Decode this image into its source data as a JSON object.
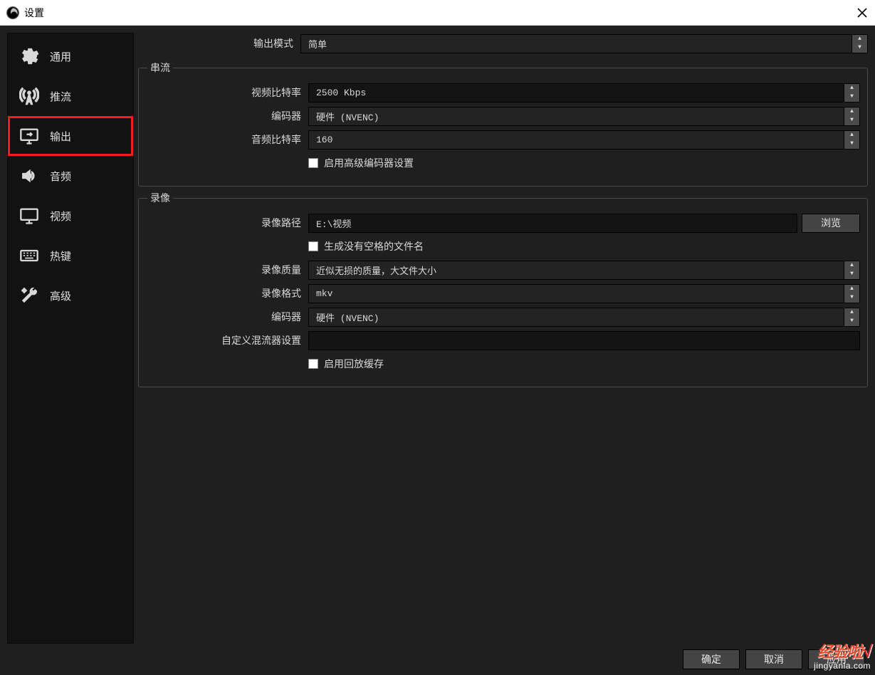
{
  "window": {
    "title": "设置",
    "close_label": "×"
  },
  "sidebar": {
    "items": [
      {
        "label": "通用"
      },
      {
        "label": "推流"
      },
      {
        "label": "输出"
      },
      {
        "label": "音频"
      },
      {
        "label": "视频"
      },
      {
        "label": "热键"
      },
      {
        "label": "高级"
      }
    ]
  },
  "output_mode": {
    "label": "输出模式",
    "value": "简单"
  },
  "streaming": {
    "title": "串流",
    "video_bitrate_label": "视频比特率",
    "video_bitrate_value": "2500 Kbps",
    "encoder_label": "编码器",
    "encoder_value": "硬件 (NVENC)",
    "audio_bitrate_label": "音频比特率",
    "audio_bitrate_value": "160",
    "enable_advanced_label": "启用高级编码器设置"
  },
  "recording": {
    "title": "录像",
    "path_label": "录像路径",
    "path_value": "E:\\视频",
    "browse_label": "浏览",
    "gen_no_space_label": "生成没有空格的文件名",
    "quality_label": "录像质量",
    "quality_value": "近似无损的质量，大文件大小",
    "format_label": "录像格式",
    "format_value": "mkv",
    "encoder_label": "编码器",
    "encoder_value": "硬件 (NVENC)",
    "muxer_label": "自定义混流器设置",
    "muxer_value": "",
    "enable_replay_label": "启用回放缓存"
  },
  "footer": {
    "ok": "确定",
    "cancel": "取消",
    "apply": "应用"
  },
  "watermark": {
    "line1": "经验啦",
    "check": "√",
    "line2": "jingyanla.com"
  }
}
